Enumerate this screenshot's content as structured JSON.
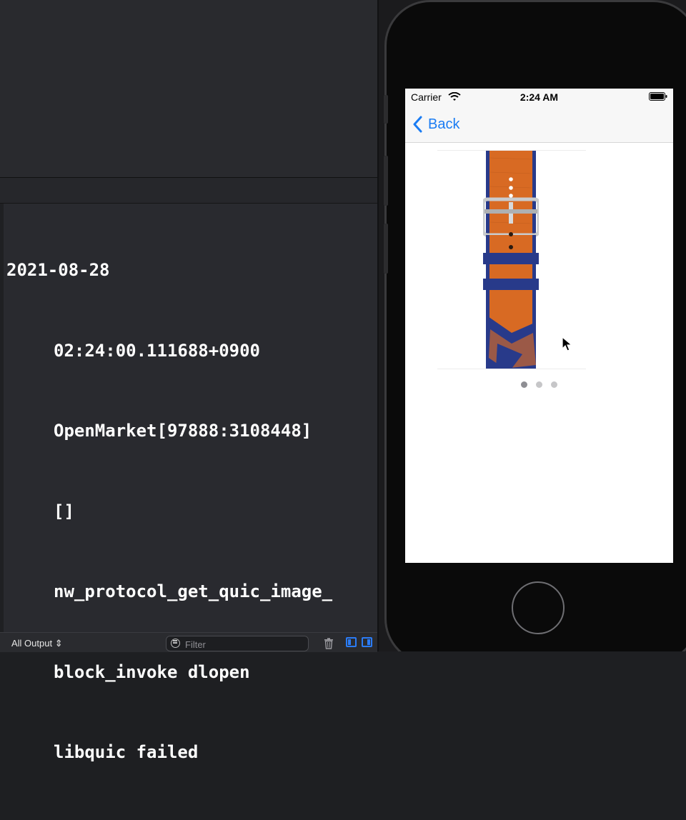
{
  "console": {
    "lines": [
      "2021-08-28",
      "02:24:00.111688+0900",
      "OpenMarket[97888:3108448]",
      "[]",
      "nw_protocol_get_quic_image_",
      "block_invoke dlopen",
      "libquic failed"
    ]
  },
  "bottom_bar": {
    "output_label": "All Output ⇕",
    "filter_placeholder": "Filter",
    "accent": "#2b7cf7"
  },
  "simulator": {
    "status_bar": {
      "carrier": "Carrier",
      "time": "2:24 AM"
    },
    "nav": {
      "back_label": "Back",
      "tint": "#1a7cf3"
    },
    "carousel": {
      "page_count": 3,
      "current_page": 1
    },
    "colors": {
      "band_orange": "#d86a23",
      "band_navy": "#283a8a"
    }
  }
}
